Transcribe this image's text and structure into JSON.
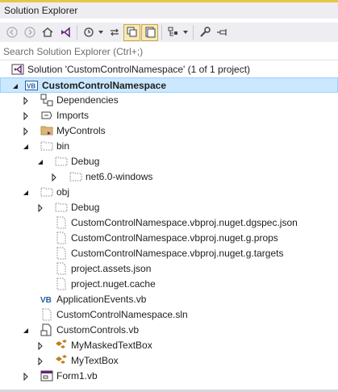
{
  "window": {
    "title": "Solution Explorer"
  },
  "search": {
    "placeholder": "Search Solution Explorer (Ctrl+;)"
  },
  "toolbar": {
    "buttons": [
      "back-icon",
      "forward-icon",
      "home-icon",
      "vs-switch-views-icon",
      "history-icon",
      "sync-icon",
      "collapse-all-icon",
      "show-all-files-icon",
      "preview-selected-icon",
      "properties-icon",
      "pin-icon"
    ]
  },
  "tree": {
    "solution": "Solution 'CustomControlNamespace' (1 of 1 project)",
    "project": "CustomControlNamespace",
    "dependencies": "Dependencies",
    "imports": "Imports",
    "mycontrols": "MyControls",
    "bin": "bin",
    "bin_debug": "Debug",
    "net6": "net6.0-windows",
    "obj": "obj",
    "obj_debug": "Debug",
    "dgspec": "CustomControlNamespace.vbproj.nuget.dgspec.json",
    "gprops": "CustomControlNamespace.vbproj.nuget.g.props",
    "gtargets": "CustomControlNamespace.vbproj.nuget.g.targets",
    "assets": "project.assets.json",
    "cache": "project.nuget.cache",
    "appevents": "ApplicationEvents.vb",
    "sln": "CustomControlNamespace.sln",
    "customcontrols": "CustomControls.vb",
    "masked": "MyMaskedTextBox",
    "textbox": "MyTextBox",
    "form1": "Form1.vb"
  }
}
